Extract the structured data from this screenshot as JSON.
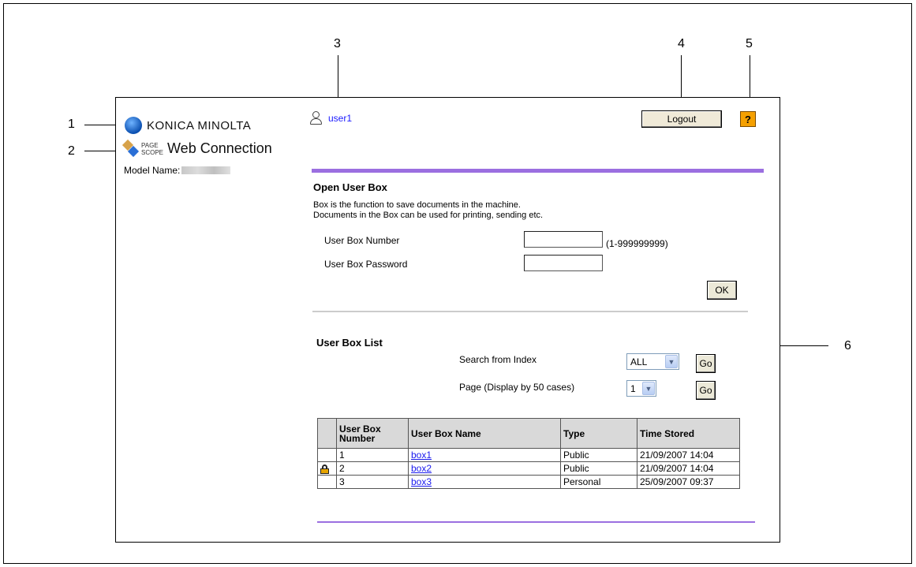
{
  "callouts": [
    "1",
    "2",
    "3",
    "4",
    "5",
    "6"
  ],
  "brand": {
    "logo_text": "KONICA MINOLTA",
    "pagescope_top": "PAGE",
    "pagescope_bottom": "SCOPE",
    "product_name": "Web Connection",
    "model_label": "Model Name:"
  },
  "header": {
    "user_name": "user1",
    "logout_label": "Logout",
    "help_label": "?"
  },
  "open_box": {
    "title": "Open User Box",
    "desc_line1": "Box is the function to save documents in the machine.",
    "desc_line2": "Documents in the Box can be used for printing, sending etc.",
    "number_label": "User Box Number",
    "number_value": "",
    "number_range": "(1-999999999)",
    "password_label": "User Box Password",
    "password_value": "",
    "ok_label": "OK"
  },
  "box_list": {
    "title": "User Box List",
    "search_label": "Search from Index",
    "search_value": "ALL",
    "page_label": "Page (Display by 50 cases)",
    "page_value": "1",
    "go_label": "Go",
    "columns": [
      "User Box Number",
      "User Box Name",
      "Type",
      "Time Stored"
    ],
    "rows": [
      {
        "locked": false,
        "number": "1",
        "name": "box1",
        "type": "Public",
        "time": "21/09/2007 14:04"
      },
      {
        "locked": true,
        "number": "2",
        "name": "box2",
        "type": "Public",
        "time": "21/09/2007 14:04"
      },
      {
        "locked": false,
        "number": "3",
        "name": "box3",
        "type": "Personal",
        "time": "25/09/2007 09:37"
      }
    ]
  },
  "icons": {
    "user": "user-icon",
    "help": "help-icon",
    "lock": "lock-icon",
    "logo": "konica-minolta-logo-icon",
    "pagescope": "pagescope-logo-icon"
  },
  "colors": {
    "accent_purple": "#9b6fe0",
    "help_orange": "#f5a000",
    "link_blue": "#1a1aee"
  }
}
